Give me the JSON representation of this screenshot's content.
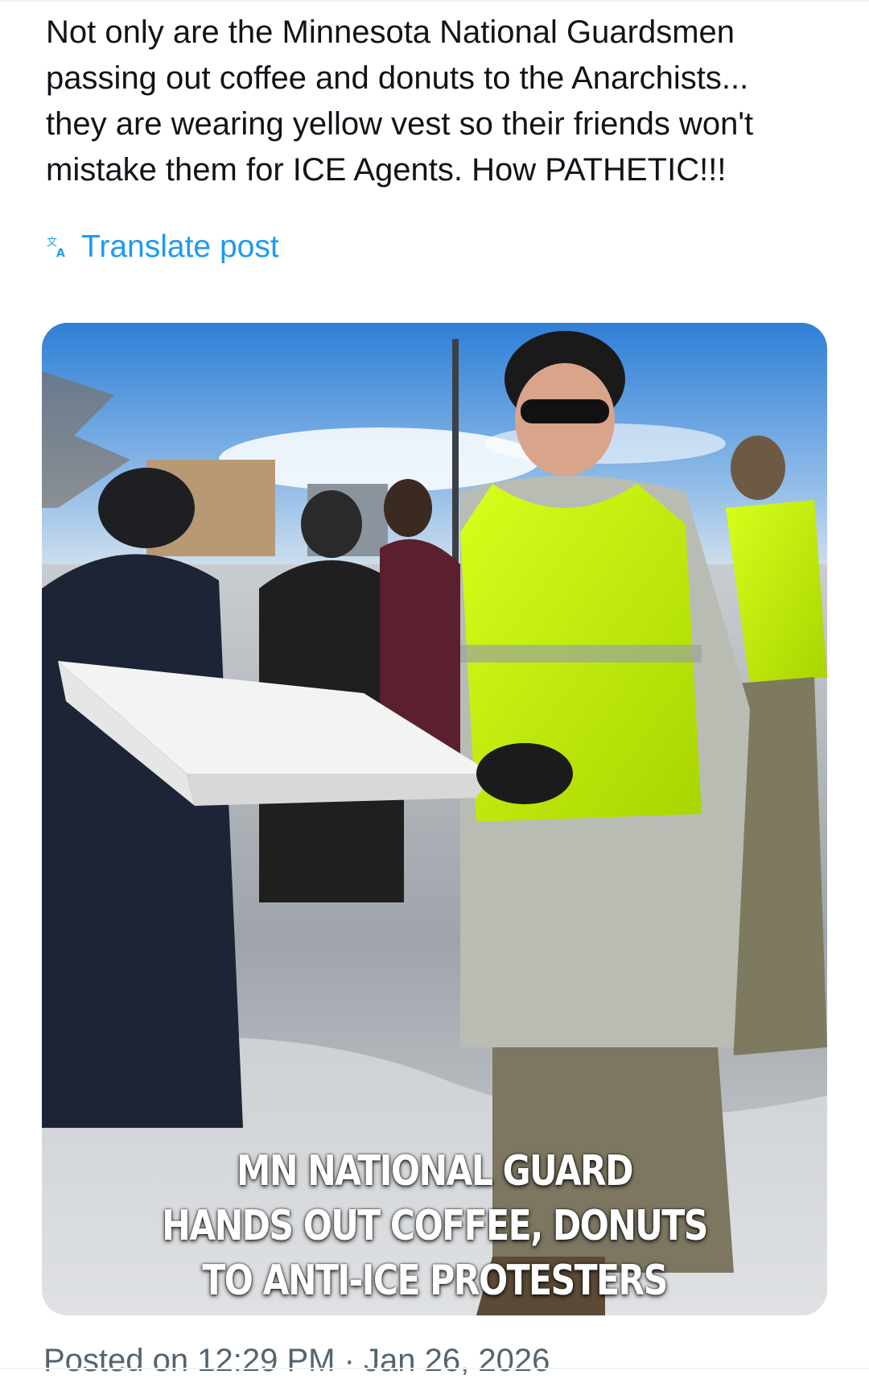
{
  "post": {
    "text": "Not only are the Minnesota National Guardsmen\npassing out coffee and donuts to the Anarchists...\nthey are wearing yellow vest so their friends won't\nmistake them for ICE Agents. How PATHETIC!!!",
    "translate_label": "Translate post",
    "translate_icon": "translate-icon",
    "media": {
      "caption_lines": [
        "MN NATIONAL GUARD",
        "HANDS OUT COFFEE, DONUTS",
        "TO ANTI-ICE PROTESTERS"
      ],
      "underline_color": "#e11c1c"
    },
    "posted_meta": "Posted on 12:29 PM · Jan 26, 2026"
  },
  "colors": {
    "link": "#1d9bf0",
    "text": "#0f1419",
    "muted": "#536471",
    "vest": "#c8f000"
  }
}
